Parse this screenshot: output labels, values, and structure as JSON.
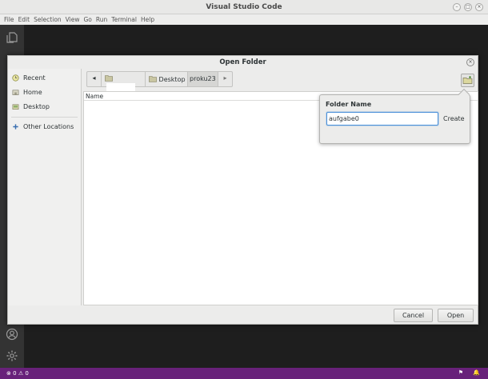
{
  "window": {
    "title": "Visual Studio Code"
  },
  "menu": [
    "File",
    "Edit",
    "Selection",
    "View",
    "Go",
    "Run",
    "Terminal",
    "Help"
  ],
  "dialog": {
    "title": "Open Folder",
    "places": [
      {
        "label": "Recent",
        "icon": "clock-icon"
      },
      {
        "label": "Home",
        "icon": "home-icon"
      },
      {
        "label": "Desktop",
        "icon": "desktop-icon"
      },
      {
        "label": "Other Locations",
        "icon": "plus-icon"
      }
    ],
    "path": {
      "segments": [
        "Desktop",
        "proku23"
      ]
    },
    "column_header": "Name",
    "cancel_label": "Cancel",
    "open_label": "Open"
  },
  "popover": {
    "label": "Folder Name",
    "input_value": "aufgabe0",
    "create_label": "Create"
  },
  "status": {
    "errors": "0",
    "warnings": "0"
  },
  "colors": {
    "status_bar": "#68217a",
    "accent": "#4a90d9"
  }
}
